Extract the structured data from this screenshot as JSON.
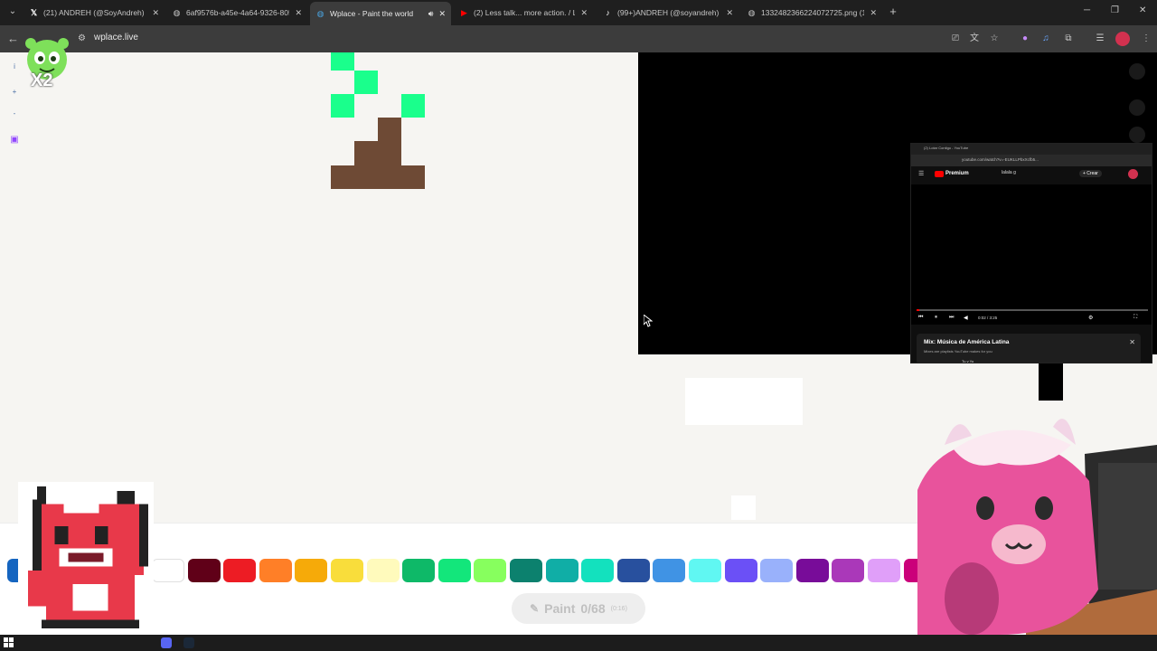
{
  "browser": {
    "tabs": [
      {
        "title": "(21) ANDREH (@SoyAndreh) / X",
        "favicon": "x-logo-icon",
        "active": false
      },
      {
        "title": "6af9576b-a45e-4a64-9326-805",
        "favicon": "globe-icon",
        "active": false
      },
      {
        "title": "Wplace - Paint the world",
        "favicon": "wplace-globe-icon",
        "active": true
      },
      {
        "title": "(2) Less talk... more action. / Lo",
        "favicon": "youtube-icon",
        "active": false
      },
      {
        "title": "(99+)ANDREH (@soyandreh) |",
        "favicon": "tiktok-icon",
        "active": false
      },
      {
        "title": "1332482366224072725.png (11",
        "favicon": "globe-icon",
        "active": false
      }
    ],
    "url": "wplace.live"
  },
  "canvas": {
    "pixel_colors": {
      "green": "#1aff8c",
      "brown": "#6e4a35"
    }
  },
  "sidebar": {
    "info_label": "i",
    "zoom_in_label": "+",
    "zoom_out_label": "-"
  },
  "mini_window": {
    "tab_title": "(2) Lotar Contigo - YouTube",
    "url": "youtube.com/watch?v=-EUKLLPbxXcfb5...",
    "brand": "Premium",
    "search_text": "lalala g",
    "create_label": "+ Crear",
    "time": "0:02 / 3:25",
    "progress": 0.01,
    "mix_title": "Mix: Música de América Latina",
    "mix_subtitle": "Mixes are playlists YouTube makes for you",
    "mix_item": "Tu y Yo"
  },
  "palette": {
    "colors": [
      "#ffffff",
      "#600018",
      "#ed1c24",
      "#ff7f27",
      "#f6aa09",
      "#f9dd3b",
      "#fffabc",
      "#0eb968",
      "#13e67b",
      "#87ff5e",
      "#0c816e",
      "#10aea6",
      "#13e1be",
      "#28509e",
      "#4093e4",
      "#60f7f2",
      "#6b50f6",
      "#99b1fb",
      "#780c99",
      "#aa38b9",
      "#e09ff9",
      "#cb007a"
    ],
    "selected": "#1565c0"
  },
  "paint_button": {
    "label": "Paint",
    "count": "0/68",
    "timer": "(0:16)"
  },
  "overlay": {
    "multiplier": "X2"
  }
}
